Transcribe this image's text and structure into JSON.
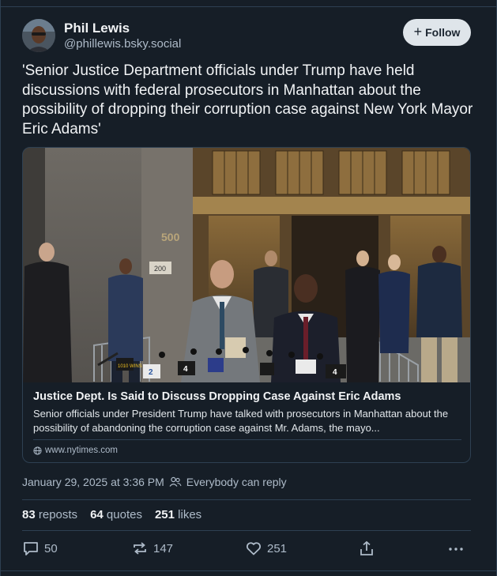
{
  "author": {
    "name": "Phil Lewis",
    "handle": "@phillewis.bsky.social",
    "follow_label": "Follow"
  },
  "post": {
    "text": "'Senior Justice Department officials under Trump have held discussions with federal prosecutors in Manhattan about the possibility of dropping their corruption case against New York Mayor Eric Adams'"
  },
  "embed": {
    "title": "Justice Dept. Is Said to Discuss Dropping Case Against Eric Adams",
    "description": "Senior officials under President Trump have talked with prosecutors in Manhattan about the possibility of abandoning the corruption case against Mr. Adams, the mayo...",
    "domain": "www.nytimes.com",
    "image_text": {
      "building_number": "500",
      "door_number": "200",
      "mic_flag_1": "1010 WINS",
      "mic_flag_2": "2",
      "mic_flag_3": "4",
      "mic_flag_4": "4"
    }
  },
  "meta": {
    "timestamp": "January 29, 2025 at 3:36 PM",
    "reply_setting": "Everybody can reply"
  },
  "stats": {
    "reposts_count": "83",
    "reposts_label": "reposts",
    "quotes_count": "64",
    "quotes_label": "quotes",
    "likes_count": "251",
    "likes_label": "likes"
  },
  "actions": {
    "reply_count": "50",
    "repost_count": "147",
    "like_count": "251"
  },
  "colors": {
    "background": "#161e27",
    "border": "#2e4052",
    "text_primary": "#f1f3f5",
    "text_secondary": "#aebbc9",
    "follow_button_bg": "#dfe5ea"
  }
}
